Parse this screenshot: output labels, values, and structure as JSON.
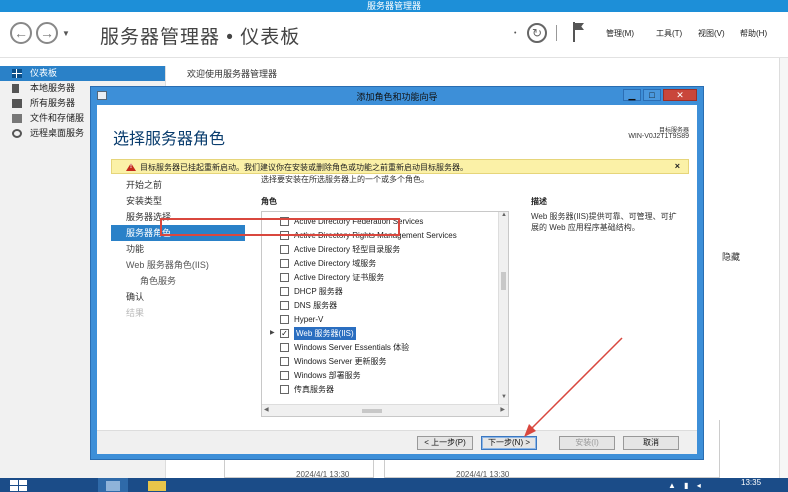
{
  "server_manager": {
    "window_title": "服务器管理器",
    "breadcrumb": "服务器管理器 • 仪表板",
    "menus": [
      "管理(M)",
      "工具(T)",
      "视图(V)",
      "帮助(H)"
    ],
    "sidebar": [
      {
        "label": "仪表板",
        "icon": "dashboard-icon",
        "active": true
      },
      {
        "label": "本地服务器",
        "icon": "server-icon"
      },
      {
        "label": "所有服务器",
        "icon": "servers-icon"
      },
      {
        "label": "文件和存储服",
        "icon": "file-storage-icon"
      },
      {
        "label": "远程桌面服务",
        "icon": "remote-desktop-icon"
      }
    ],
    "welcome": "欢迎使用服务器管理器",
    "hide": "隐藏",
    "timestamps": [
      "2024/4/1 13:30",
      "2024/4/1 13:30"
    ]
  },
  "dialog": {
    "title": "添加角色和功能向导",
    "heading": "选择服务器角色",
    "target_label": "目标服务器",
    "target_name": "WIN-V0J2T1T9S89",
    "warning": "目标服务器已挂起重新启动。我们建议你在安装或删除角色或功能之前重新启动目标服务器。",
    "warning_close": "×",
    "nav": [
      {
        "label": "开始之前",
        "state": "done"
      },
      {
        "label": "安装类型",
        "state": "done"
      },
      {
        "label": "服务器选择",
        "state": "done"
      },
      {
        "label": "服务器角色",
        "state": "active"
      },
      {
        "label": "功能",
        "state": "done"
      },
      {
        "label": "Web 服务器角色(IIS)",
        "state": "normal"
      },
      {
        "label": "角色服务",
        "state": "normal",
        "sub": true
      },
      {
        "label": "确认",
        "state": "done"
      },
      {
        "label": "结果",
        "state": "disabled"
      }
    ],
    "instruction": "选择要安装在所选服务器上的一个或多个角色。",
    "roles_label": "角色",
    "roles": [
      {
        "label": "Active Directory Federation Services",
        "checked": false
      },
      {
        "label": "Active Directory Rights Management Services",
        "checked": false
      },
      {
        "label": "Active Directory 轻型目录服务",
        "checked": false
      },
      {
        "label": "Active Directory 域服务",
        "checked": false
      },
      {
        "label": "Active Directory 证书服务",
        "checked": false
      },
      {
        "label": "DHCP 服务器",
        "checked": false
      },
      {
        "label": "DNS 服务器",
        "checked": false
      },
      {
        "label": "Hyper-V",
        "checked": false
      },
      {
        "label": "Web 服务器(IIS)",
        "checked": true,
        "selected": true,
        "expandable": true
      },
      {
        "label": "Windows Server Essentials 体验",
        "checked": false
      },
      {
        "label": "Windows Server 更新服务",
        "checked": false
      },
      {
        "label": "Windows 部署服务",
        "checked": false
      },
      {
        "label": "传真服务器",
        "checked": false
      }
    ],
    "description_label": "描述",
    "description": "Web 服务器(IIS)提供可靠、可管理、可扩展的 Web 应用程序基础结构。",
    "buttons": {
      "prev": "< 上一步(P)",
      "next": "下一步(N) >",
      "install": "安装(I)",
      "cancel": "取消"
    },
    "check_mark": "✓"
  },
  "taskbar": {
    "clock": "13:35"
  },
  "colors": {
    "accent": "#2a81c8",
    "titlebar": "#1d8fd8",
    "warning_bg": "#fbf1a7",
    "highlight_red": "#d9473e",
    "taskbar": "#1b4c88"
  }
}
